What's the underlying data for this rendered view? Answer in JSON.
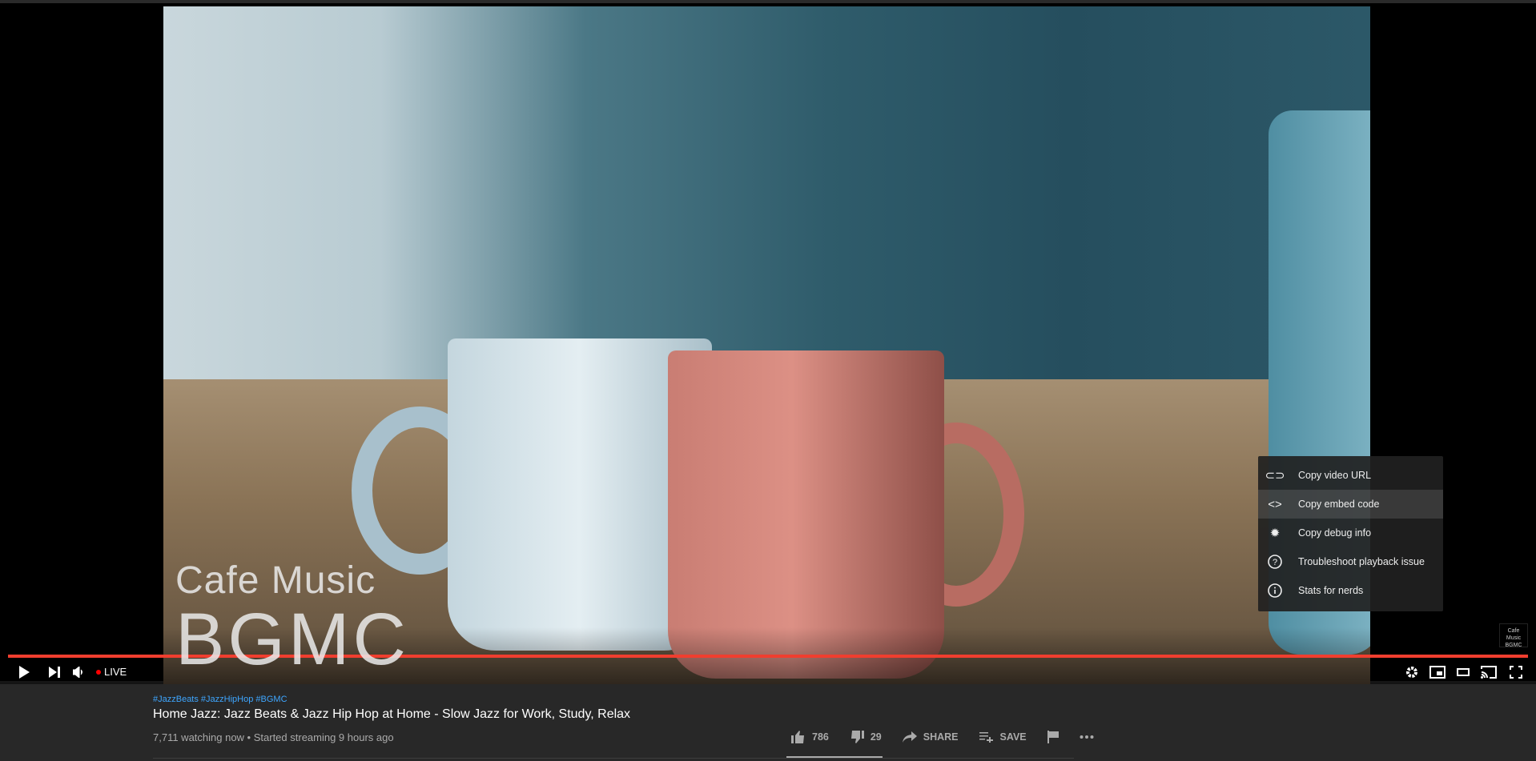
{
  "video": {
    "watermark_line1": "Cafe Music",
    "watermark_line2": "BGMC",
    "corner_logo": "Cafe Music BGMC"
  },
  "controls": {
    "play": "play-icon",
    "next": "next-icon",
    "volume": "volume-icon",
    "live_label": "LIVE",
    "live_dot_color": "#ff0000",
    "progress_color": "#f03e2f",
    "right": [
      "settings-icon",
      "miniplayer-icon",
      "theater-mode-icon",
      "cast-icon",
      "fullscreen-icon"
    ]
  },
  "context_menu": {
    "items": [
      {
        "label": "Copy video URL",
        "icon": "link-icon"
      },
      {
        "label": "Copy embed code",
        "icon": "code-icon",
        "highlighted": true
      },
      {
        "label": "Copy debug info",
        "icon": "bug-icon"
      },
      {
        "label": "Troubleshoot playback issue",
        "icon": "help-icon"
      },
      {
        "label": "Stats for nerds",
        "icon": "info-icon"
      }
    ]
  },
  "info": {
    "hashtags": "#JazzBeats #JazzHipHop #BGMC",
    "title": "Home Jazz: Jazz Beats & Jazz Hip Hop at Home - Slow Jazz for Work, Study, Relax",
    "meta": "7,711 watching now • Started streaming 9 hours ago"
  },
  "actions": {
    "likes": "786",
    "dislikes": "29",
    "share": "SHARE",
    "save": "SAVE"
  }
}
